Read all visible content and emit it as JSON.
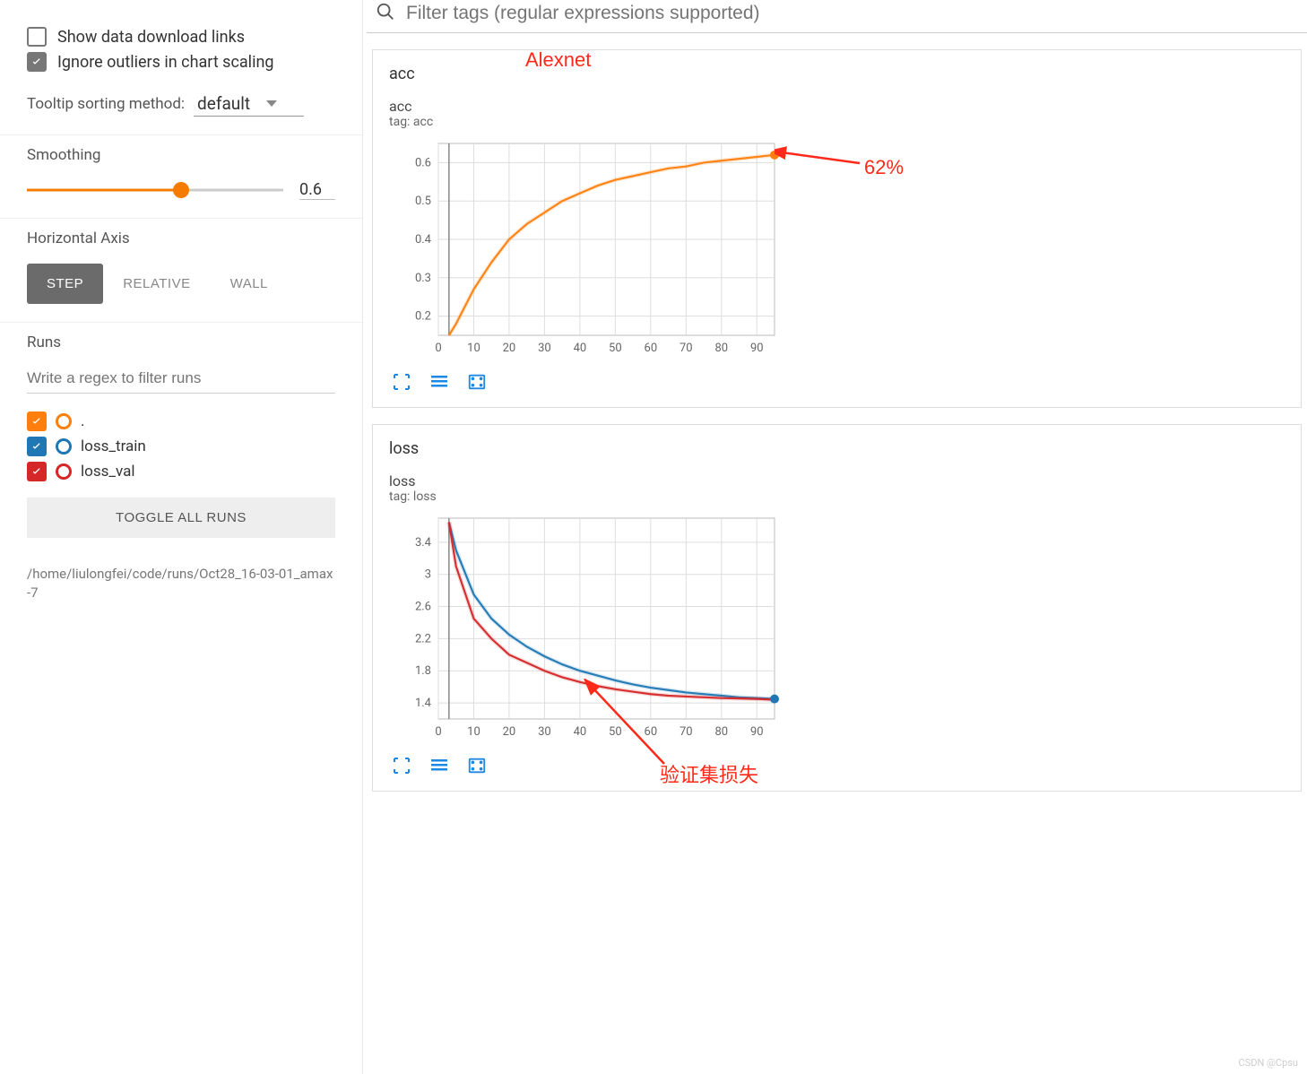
{
  "sidebar": {
    "show_download_label": "Show data download links",
    "show_download_checked": false,
    "ignore_outliers_label": "Ignore outliers in chart scaling",
    "ignore_outliers_checked": true,
    "tooltip_label": "Tooltip sorting method:",
    "tooltip_value": "default",
    "smoothing_label": "Smoothing",
    "smoothing_value": "0.6",
    "smoothing_fraction": 0.6,
    "haxis_label": "Horizontal Axis",
    "haxis_options": [
      "STEP",
      "RELATIVE",
      "WALL"
    ],
    "haxis_active": "STEP",
    "runs_label": "Runs",
    "runs_filter_placeholder": "Write a regex to filter runs",
    "runs": [
      {
        "name": ".",
        "color": "#ff7f0e",
        "checked": true
      },
      {
        "name": "loss_train",
        "color": "#1f77b4",
        "checked": true
      },
      {
        "name": "loss_val",
        "color": "#d62728",
        "checked": true
      }
    ],
    "toggle_all": "TOGGLE ALL RUNS",
    "logdir": "/home/liulongfei/code/runs/Oct28_16-03-01_amax-7"
  },
  "search": {
    "placeholder": "Filter tags (regular expressions supported)"
  },
  "annotations": {
    "alexnet": "Alexnet",
    "acc62": "62%",
    "val_loss": "验证集损失"
  },
  "chart_data": [
    {
      "type": "line",
      "panel": "acc",
      "title": "acc",
      "tag": "tag: acc",
      "xlabel": "",
      "ylabel": "",
      "xlim": [
        0,
        95
      ],
      "ylim": [
        0.15,
        0.65
      ],
      "xticks": [
        0,
        10,
        20,
        30,
        40,
        50,
        60,
        70,
        80,
        90
      ],
      "yticks": [
        0.2,
        0.3,
        0.4,
        0.5,
        0.6
      ],
      "series": [
        {
          "name": ".",
          "color": "#ff7f0e",
          "x": [
            3,
            5,
            10,
            15,
            20,
            25,
            30,
            35,
            40,
            45,
            50,
            55,
            60,
            65,
            70,
            75,
            80,
            85,
            90,
            95
          ],
          "y": [
            0.15,
            0.18,
            0.27,
            0.34,
            0.4,
            0.44,
            0.47,
            0.5,
            0.52,
            0.54,
            0.555,
            0.565,
            0.575,
            0.585,
            0.59,
            0.6,
            0.605,
            0.61,
            0.615,
            0.62
          ]
        }
      ],
      "end_marker": {
        "x": 95,
        "y": 0.62,
        "color": "#ff7f0e"
      }
    },
    {
      "type": "line",
      "panel": "loss",
      "title": "loss",
      "tag": "tag: loss",
      "xlabel": "",
      "ylabel": "",
      "xlim": [
        0,
        95
      ],
      "ylim": [
        1.2,
        3.7
      ],
      "xticks": [
        0,
        10,
        20,
        30,
        40,
        50,
        60,
        70,
        80,
        90
      ],
      "yticks": [
        1.4,
        1.8,
        2.2,
        2.6,
        3.0,
        3.4
      ],
      "series": [
        {
          "name": "loss_train",
          "color": "#1f77b4",
          "x": [
            3,
            5,
            10,
            15,
            20,
            25,
            30,
            35,
            40,
            45,
            50,
            55,
            60,
            65,
            70,
            75,
            80,
            85,
            90,
            95
          ],
          "y": [
            3.65,
            3.3,
            2.75,
            2.45,
            2.25,
            2.1,
            1.98,
            1.88,
            1.8,
            1.74,
            1.68,
            1.63,
            1.59,
            1.56,
            1.53,
            1.51,
            1.49,
            1.47,
            1.46,
            1.45
          ]
        },
        {
          "name": "loss_val",
          "color": "#d62728",
          "x": [
            3,
            5,
            10,
            15,
            20,
            25,
            30,
            35,
            40,
            45,
            50,
            55,
            60,
            65,
            70,
            75,
            80,
            85,
            90,
            95
          ],
          "y": [
            3.65,
            3.1,
            2.45,
            2.2,
            2.0,
            1.9,
            1.8,
            1.72,
            1.66,
            1.61,
            1.57,
            1.54,
            1.51,
            1.49,
            1.48,
            1.47,
            1.46,
            1.455,
            1.45,
            1.44
          ]
        }
      ],
      "end_marker": {
        "x": 95,
        "y": 1.45,
        "color": "#1f77b4"
      }
    }
  ],
  "watermark": "CSDN @Cpsu"
}
